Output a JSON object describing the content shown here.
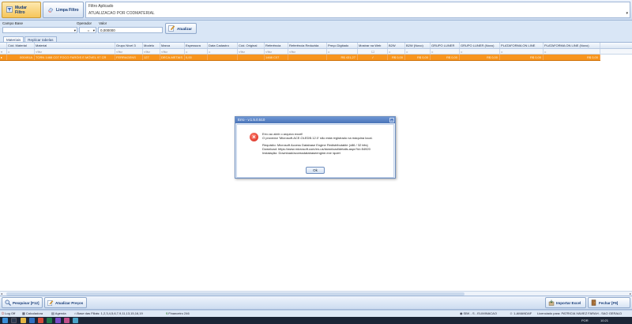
{
  "toolbar": {
    "mudar_filtro": "Mudar Filtro",
    "limpa_filtro": "Limpa Filtro",
    "filtro_aplicado_label": "Filtro Aplicado",
    "filtro_aplicado_value": "ATUALIZACAO POR CODMATERIAL"
  },
  "criteria": {
    "campo_base_label": "Campo Base",
    "campo_base_value": "",
    "operador_label": "Operador",
    "operador_value": "=",
    "valor_label": "Valor",
    "valor_value": "0,000000",
    "atualizar_label": "Atualizar"
  },
  "tabs": [
    {
      "label": "Materiais"
    },
    {
      "label": "Replicar tabelas"
    }
  ],
  "grid": {
    "columns": [
      "Cód. Material",
      "Material",
      "Grupo Nível 3",
      "Modelo",
      "Marca",
      "Espessura",
      "Data Cadastro",
      "Cód. Original",
      "Referência",
      "Referência Reduzida",
      "Preço Digitado",
      "Mostrar na Web",
      "B2W",
      "B2W (Novo)",
      "GRUPO LUNER",
      "GRUPO LUNER (Novo)",
      "PLATAFORMA ON LINE",
      "PLATAFORMA ON LINE (Novo)"
    ],
    "row": [
      "000491A",
      "TORN 1468 C07 FOCO FARÓIS E MÓVEL 97 CR",
      "FERRAGENS",
      "127",
      "DECA-METAIS",
      "0,00",
      "",
      "",
      "1468 C07",
      "",
      "R$ 431,27",
      "✓",
      "R$ 0,00",
      "R$ 0,00",
      "R$ 0,00",
      "R$ 0,00",
      "R$ 0,00",
      "R$ 0,00"
    ]
  },
  "bottom": {
    "pesquisar": "Pesquisar [F12]",
    "atualizar_precos": "Atualizar Preços",
    "importar_excel": "Importar Excel",
    "fechar": "Fechar [F9]"
  },
  "status": {
    "logoff": "Log Off",
    "calculadora": "Calculadora",
    "agenda": "Agenda",
    "base_filiais": "Base das Filiais: 1,2,3,4,5,6,7,9,11,13,15,16,19",
    "financeiro": "Financeiro 246",
    "sbk": "SBK - S - ELIMINACAO",
    "user": "1-AMANDAF",
    "licenciado": "Licenciado para: PATRICIA XAVIEZ FARAH - SAO GERALD"
  },
  "taskbar": {
    "lang": "POR",
    "time": "10:21"
  },
  "dialog": {
    "title": "Erro - v.1.5.0.510",
    "line1": "Erro ao abrir o arquivo excel!",
    "line2": "O provedor 'Microsoft.ACE.OLEDB.12.0' não está registrado na máquina local.",
    "line3": "Requisito: Microsoft Access Database Engine Redistributable  (x86 / 32 bits)",
    "line4": "Download: https://www.microsoft.com/en-us/download/details.aspx?id=54920",
    "line5": "Instalação: Download/accessdatabaseengine.exe /quiet",
    "ok_label": "Ok"
  },
  "colors": {
    "selected_row": "#f7941d",
    "accent": "#4a74b8",
    "error": "#d3261a"
  }
}
